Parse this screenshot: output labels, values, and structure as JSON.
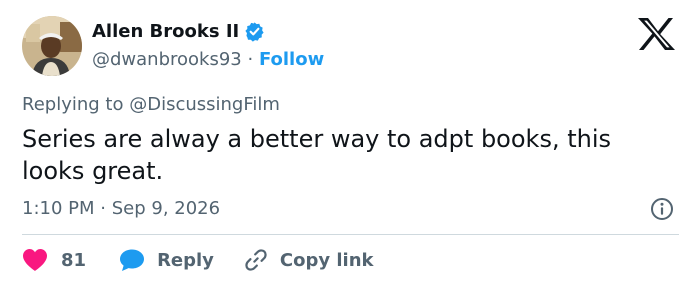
{
  "author": {
    "name": "Allen Brooks II",
    "handle": "@dwanbrooks93",
    "separator": "·",
    "follow_label": "Follow",
    "avatar": "avatar-photo",
    "verified_icon": "verified-badge-icon"
  },
  "reply_context": {
    "prefix": "Replying to",
    "mention": "@DiscussingFilm"
  },
  "tweet": {
    "text": "Series are alway a better way to adpt books, this looks great."
  },
  "meta": {
    "time": "1:10 PM",
    "separator": "·",
    "date": "Sep 9, 2026"
  },
  "actions": {
    "like_count": "81",
    "reply_label": "Reply",
    "copy_link_label": "Copy link"
  },
  "colors": {
    "accent": "#1d9bf0",
    "like": "#f91880",
    "text": "#0f1419",
    "secondary": "#536471",
    "divider": "#cfd9de"
  },
  "icons": {
    "brand": "x-logo-icon",
    "info": "info-icon",
    "like": "heart-icon",
    "reply": "speech-bubble-icon",
    "copy": "link-icon"
  }
}
